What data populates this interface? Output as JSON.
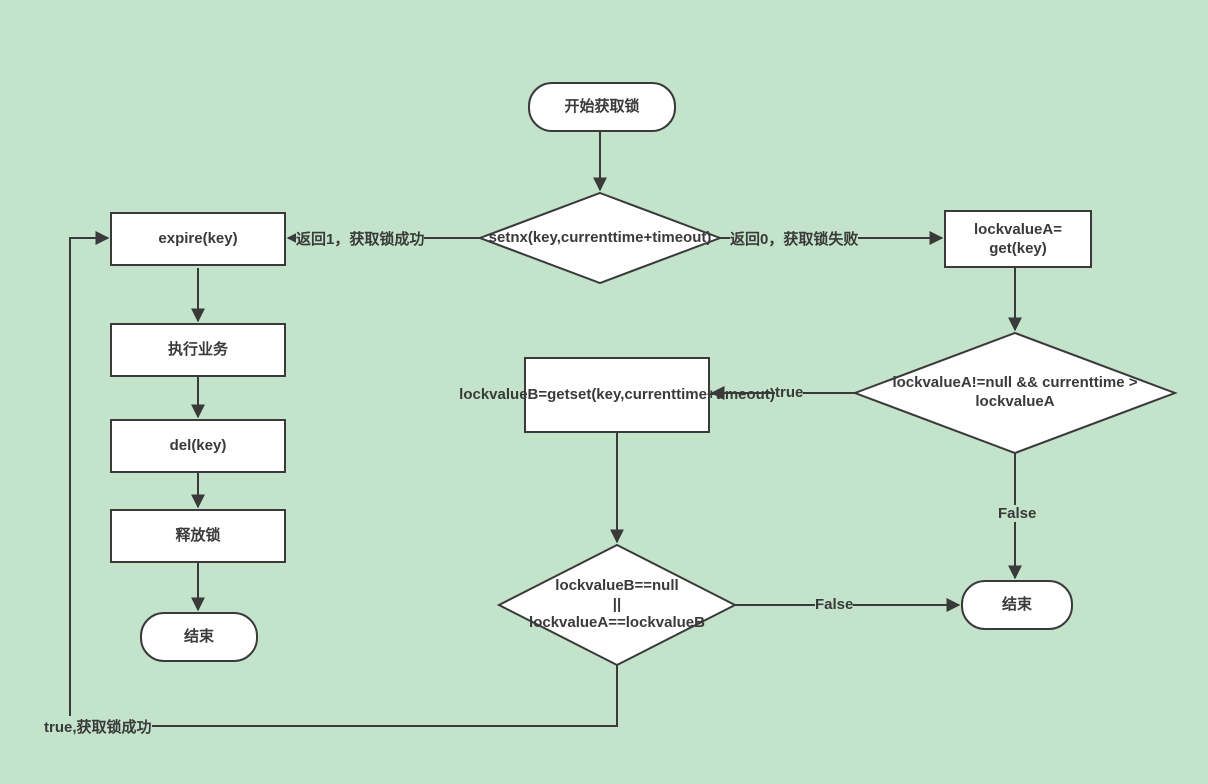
{
  "nodes": {
    "start": "开始获取锁",
    "setnx": "setnx(key,currenttime+timeout)",
    "expire": "expire(key)",
    "business": "执行业务",
    "del": "del(key)",
    "release": "释放锁",
    "end_left": "结束",
    "getA": "lockvalueA=\nget(key)",
    "condA": "lockvalueA!=null && currenttime > lockvalueA",
    "getset": "lockvalueB=getset(key,currenttime+timeout)",
    "condB": "lockvalueB==null\n||\nlockvalueA==lockvalueB",
    "end_right": "结束"
  },
  "edges": {
    "ret1": "返回1，获取锁成功",
    "ret0": "返回0，获取锁失败",
    "true1": "true",
    "false1": "False",
    "false2": "False",
    "true2": "true,获取锁成功"
  }
}
